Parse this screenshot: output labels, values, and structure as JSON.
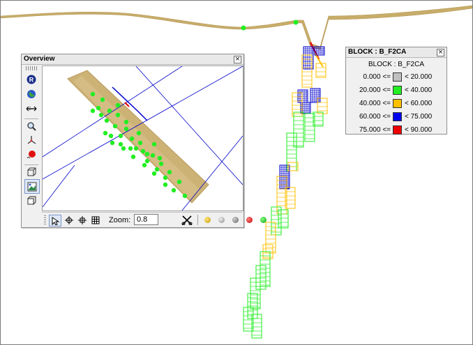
{
  "overview": {
    "title": "Overview",
    "close_glyph": "×",
    "zoom_label": "Zoom:",
    "zoom_value": "0.8",
    "toolbar_icons": [
      "rotate-icon",
      "globe-icon",
      "pan-arrows-icon",
      "magnifier-icon",
      "axis-icon",
      "light-icon",
      "box-wire-icon",
      "image-view-icon",
      "box-solid-icon"
    ],
    "bottom_icons": [
      "select-arrow-icon",
      "crosshair-icon",
      "target-icon",
      "grid-icon",
      "scissors-icon"
    ]
  },
  "legend": {
    "title": "BLOCK : B_F2CA",
    "subtitle": "BLOCK : B_F2CA",
    "close_glyph": "×",
    "rows": [
      {
        "low": "0.000 <=",
        "high": "< 20.000",
        "color": "#c0c0c0"
      },
      {
        "low": "20.000 <=",
        "high": "< 40.000",
        "color": "#22ee22"
      },
      {
        "low": "40.000 <=",
        "high": "< 60.000",
        "color": "#ffc000"
      },
      {
        "low": "60.000 <=",
        "high": "< 75.000",
        "color": "#0000ee"
      },
      {
        "low": "75.000 <=",
        "high": "< 90.000",
        "color": "#ee0000"
      }
    ]
  },
  "colors": {
    "terrain": "#c8ad6a",
    "surface_line": "#b09450",
    "green": "#22ee22",
    "yellow": "#ffc000",
    "blue": "#0000cc",
    "red": "#ee0000",
    "window_bg": "#f0f0f0"
  }
}
